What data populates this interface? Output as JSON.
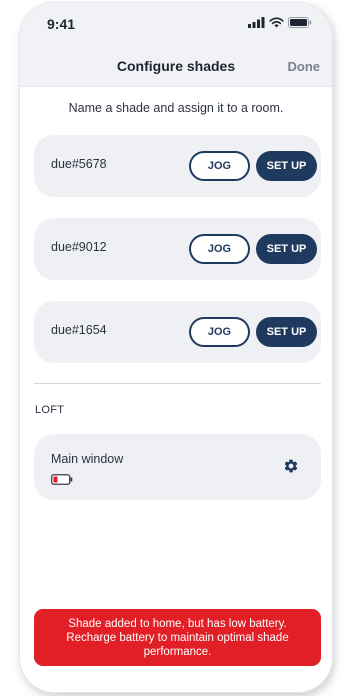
{
  "status_bar": {
    "time": "9:41",
    "icons": [
      "signal-icon",
      "wifi-icon",
      "battery-icon"
    ]
  },
  "nav": {
    "title": "Configure shades",
    "done_label": "Done"
  },
  "instruction": "Name a shade and assign it to a room.",
  "shades": [
    {
      "name": "due#5678",
      "jog_label": "JOG",
      "setup_label": "SET UP"
    },
    {
      "name": "due#9012",
      "jog_label": "JOG",
      "setup_label": "SET UP"
    },
    {
      "name": "due#1654",
      "jog_label": "JOG",
      "setup_label": "SET UP"
    }
  ],
  "room": {
    "name": "LOFT",
    "shades": [
      {
        "name": "Main window",
        "battery_status": "low",
        "action_icon": "gear-icon"
      }
    ]
  },
  "toast": {
    "message": "Shade added to home, but has low battery. Recharge battery to maintain optimal shade performance."
  },
  "colors": {
    "accent": "#1f3a5f",
    "card_background": "#eef0f4",
    "header_background": "#f1f2f5",
    "toast_background": "#e21e26",
    "battery_low": "#e21e26",
    "done_text": "#7b8190"
  }
}
